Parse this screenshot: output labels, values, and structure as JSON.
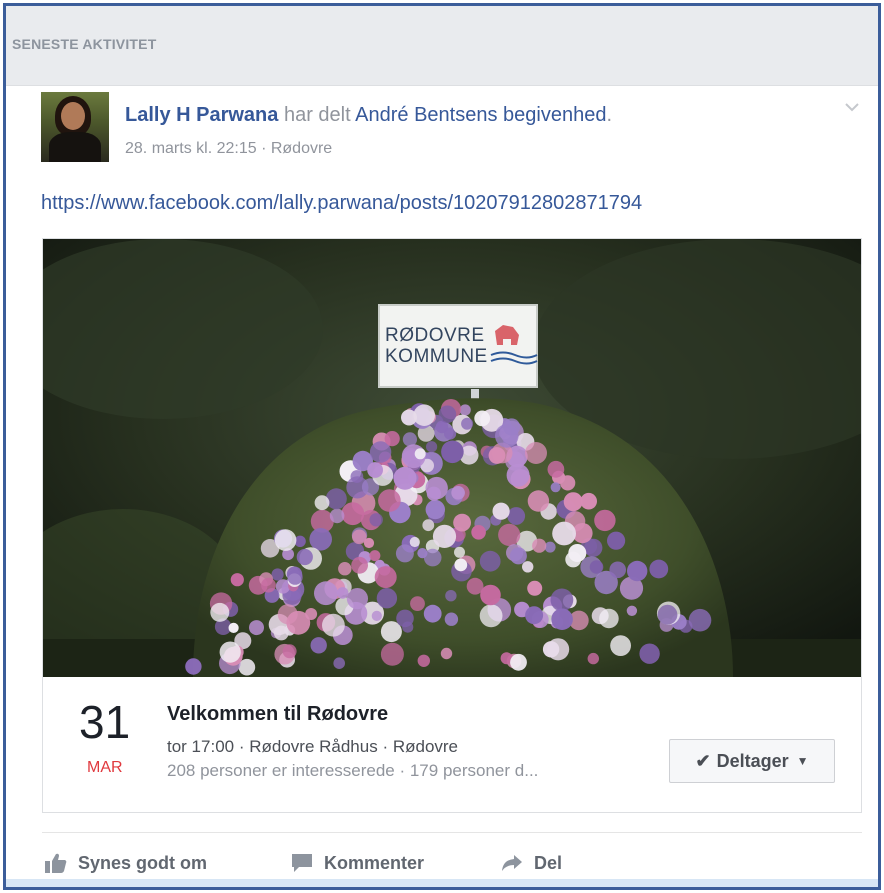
{
  "section": {
    "title": "SENESTE AKTIVITET"
  },
  "post": {
    "author": "Lally H Parwana",
    "verb": "har delt",
    "shared_owner": "André Bentsens",
    "shared_type": "begivenhed",
    "period": ".",
    "timestamp": "28. marts kl. 22:15",
    "separator": " · ",
    "location": "Rødovre",
    "url": "https://www.facebook.com/lally.parwana/posts/10207912802871794"
  },
  "photo": {
    "sign_line1": "RØDOVRE",
    "sign_line2": "KOMMUNE"
  },
  "event": {
    "day": "31",
    "month": "MAR",
    "title": "Velkommen til Rødovre",
    "when_location": "tor 17:00 · Rødovre Rådhus · Rødovre",
    "stats": "208 personer er interesserede · 179 personer d...",
    "going_label": "Deltager"
  },
  "actions": {
    "like": "Synes godt om",
    "comment": "Kommenter",
    "share": "Del"
  },
  "colors": {
    "link_blue": "#365899",
    "frame_border": "#3b5d9a",
    "month_red": "#e0393e",
    "muted_gray": "#90949c"
  },
  "icons": {
    "like": "thumbs-up-icon",
    "comment": "comment-icon",
    "share": "share-arrow-icon",
    "menu": "chevron-down-icon",
    "going": "checkmark-icon"
  }
}
